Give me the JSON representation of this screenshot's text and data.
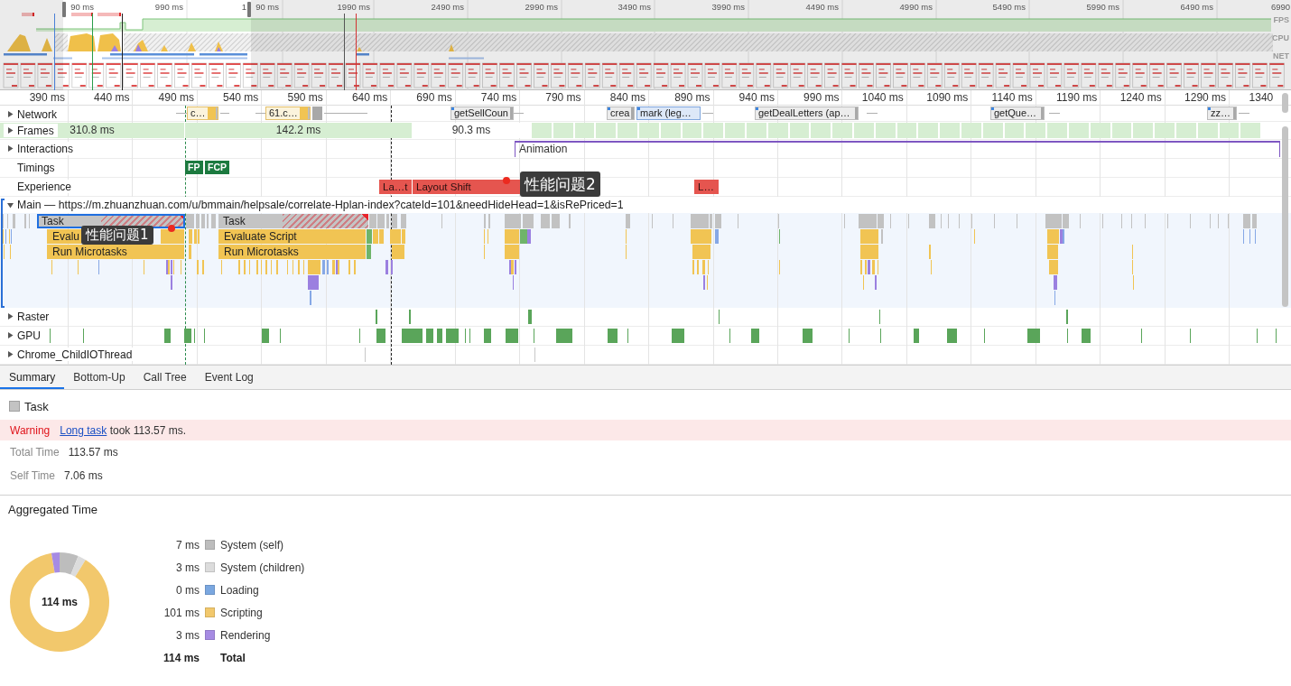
{
  "overview": {
    "ticks": [
      "90 ms",
      "990 ms",
      "1",
      "90 ms",
      "1990 ms",
      "2490 ms",
      "2990 ms",
      "3490 ms",
      "3990 ms",
      "4490 ms",
      "4990 ms",
      "5490 ms",
      "5990 ms",
      "6490 ms",
      "6990"
    ],
    "lanes": [
      "FPS",
      "CPU",
      "NET"
    ]
  },
  "timeline": {
    "ruler": [
      "390 ms",
      "440 ms",
      "490 ms",
      "540 ms",
      "590 ms",
      "640 ms",
      "690 ms",
      "740 ms",
      "790 ms",
      "840 ms",
      "890 ms",
      "940 ms",
      "990 ms",
      "1040 ms",
      "1090 ms",
      "1140 ms",
      "1190 ms",
      "1240 ms",
      "1290 ms",
      "1340"
    ],
    "tracks": [
      {
        "kind": "network",
        "label": "Network",
        "expanded": false,
        "requests": [
          {
            "label": "c…",
            "kind": "script"
          },
          {
            "label": "61.c…",
            "kind": "script"
          },
          {
            "label": "getSellCoun",
            "kind": "other"
          },
          {
            "label": "crea",
            "kind": "other"
          },
          {
            "label": "mark (leg…",
            "kind": "document"
          },
          {
            "label": "getDealLetters (ap…",
            "kind": "other"
          },
          {
            "label": "getQue…",
            "kind": "other"
          },
          {
            "label": "zz…",
            "kind": "other"
          }
        ]
      },
      {
        "kind": "frames",
        "label": "Frames",
        "expanded": false,
        "frames": [
          {
            "duration": "310.8 ms",
            "kind": "drawn"
          },
          {
            "duration": "142.2 ms",
            "kind": "drawn"
          },
          {
            "duration": "90.3 ms",
            "kind": "idle"
          }
        ]
      },
      {
        "kind": "interactions",
        "label": "Interactions",
        "expanded": false,
        "events": [
          "Animation"
        ]
      },
      {
        "kind": "timings",
        "label": "Timings",
        "marks": [
          "FP",
          "FCP"
        ]
      },
      {
        "kind": "experience",
        "label": "Experience",
        "shifts": [
          "La…t",
          "Layout Shift",
          "L…"
        ]
      },
      {
        "kind": "main",
        "label": "Main — https://m.zhuanzhuan.com/u/bmmain/helpsale/correlate-Hplan-index?cateId=101&needHideHead=1&isRePriced=1",
        "expanded": true,
        "selected": true,
        "entries": [
          {
            "name": "Task",
            "kind": "task",
            "selected": true,
            "long_task": true,
            "children": [
              {
                "name": "Evalu",
                "kind": "script",
                "selected": false,
                "children": [
                  {
                    "name": "Run Microtasks",
                    "kind": "script",
                    "selected": false
                  }
                ]
              }
            ]
          },
          {
            "name": "Task",
            "kind": "task",
            "selected": false,
            "long_task": true,
            "children": [
              {
                "name": "Evaluate Script",
                "kind": "script",
                "selected": false,
                "children": [
                  {
                    "name": "Run Microtasks",
                    "kind": "script",
                    "selected": false
                  }
                ]
              }
            ]
          }
        ]
      },
      {
        "kind": "raster",
        "label": "Raster",
        "expanded": false
      },
      {
        "kind": "gpu",
        "label": "GPU",
        "expanded": false
      },
      {
        "kind": "thread",
        "label": "Chrome_ChildIOThread",
        "expanded": false
      }
    ],
    "annotations": [
      "性能问题1",
      "性能问题2"
    ]
  },
  "details": {
    "tabs": [
      {
        "label": "Summary",
        "selected": true
      },
      {
        "label": "Bottom-Up",
        "selected": false
      },
      {
        "label": "Call Tree",
        "selected": false
      },
      {
        "label": "Event Log",
        "selected": false
      }
    ],
    "title": "Task",
    "warning": {
      "label": "Warning",
      "link": "Long task",
      "text": "took 113.57 ms."
    },
    "fields": [
      {
        "label": "Total Time",
        "value": "113.57 ms"
      },
      {
        "label": "Self Time",
        "value": "7.06 ms"
      }
    ],
    "aggregated": {
      "title": "Aggregated Time",
      "center_label": "114 ms",
      "swatches": [
        {
          "color": "#bdbdbd"
        },
        {
          "color": "#dcdcdc"
        },
        {
          "color": "#7aa7e0"
        },
        {
          "color": "#f2c86c"
        },
        {
          "color": "#a68be3"
        }
      ],
      "total": {
        "reading": "114 ms",
        "label": "Total"
      },
      "chart_data": {
        "type": "donut",
        "categories": [
          "System (self)",
          "System (children)",
          "Loading",
          "Scripting",
          "Rendering"
        ],
        "values": [
          7,
          3,
          0,
          101,
          3
        ],
        "value_labels": [
          "7 ms",
          "3 ms",
          "0 ms",
          "101 ms",
          "3 ms"
        ],
        "legend": "right"
      }
    }
  }
}
